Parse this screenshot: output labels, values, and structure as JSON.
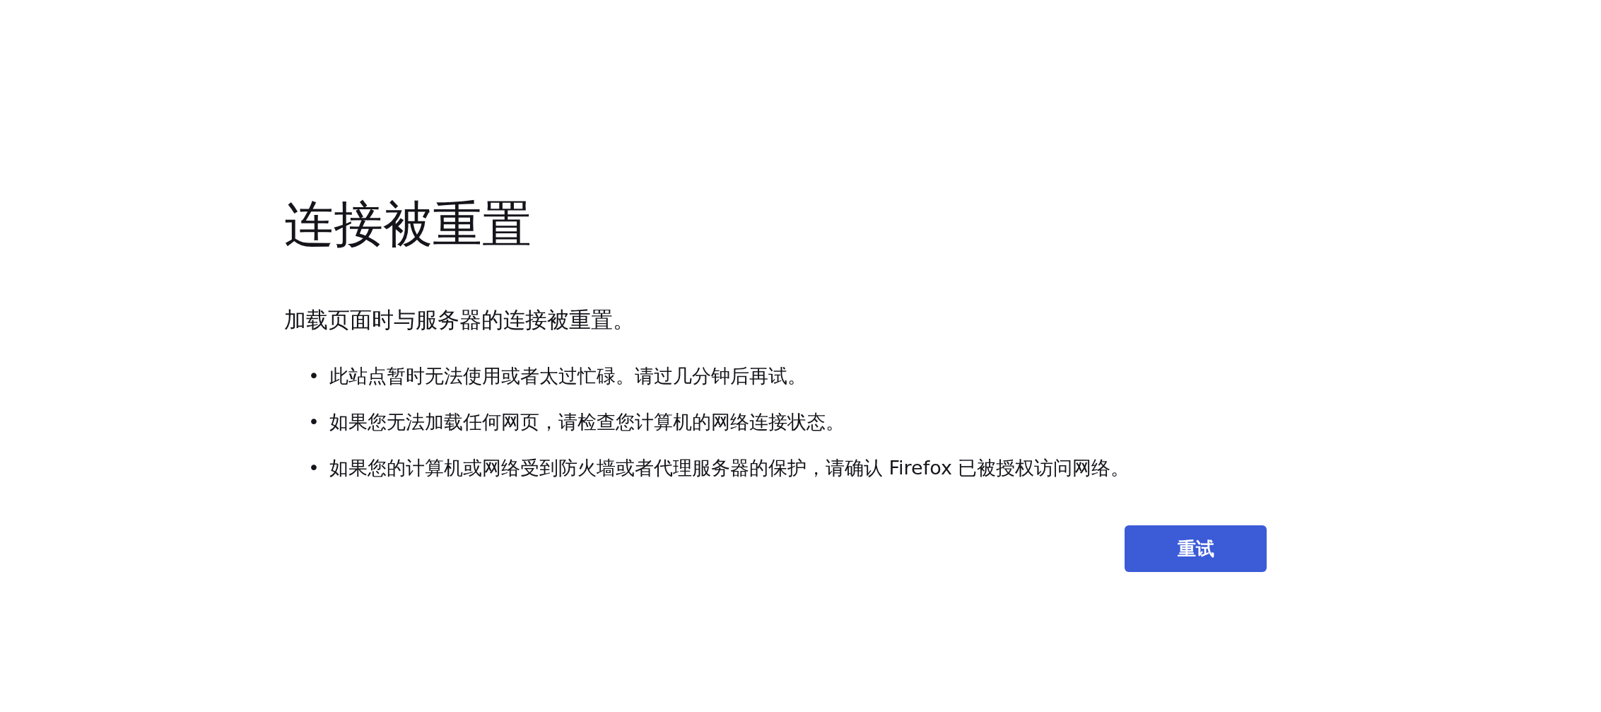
{
  "title": "连接被重置",
  "message": "加载页面时与服务器的连接被重置。",
  "suggestions": [
    {
      "bullet": "•",
      "text": "此站点暂时无法使用或者太过忙碌。请过几分钟后再试。"
    },
    {
      "bullet": "•",
      "text": "如果您无法加载任何网页，请检查您计算机的网络连接状态。"
    },
    {
      "bullet": "•",
      "text": "如果您的计算机或网络受到防火墙或者代理服务器的保护，请确认 Firefox 已被授权访问网络。"
    }
  ],
  "retry_button": "重试"
}
